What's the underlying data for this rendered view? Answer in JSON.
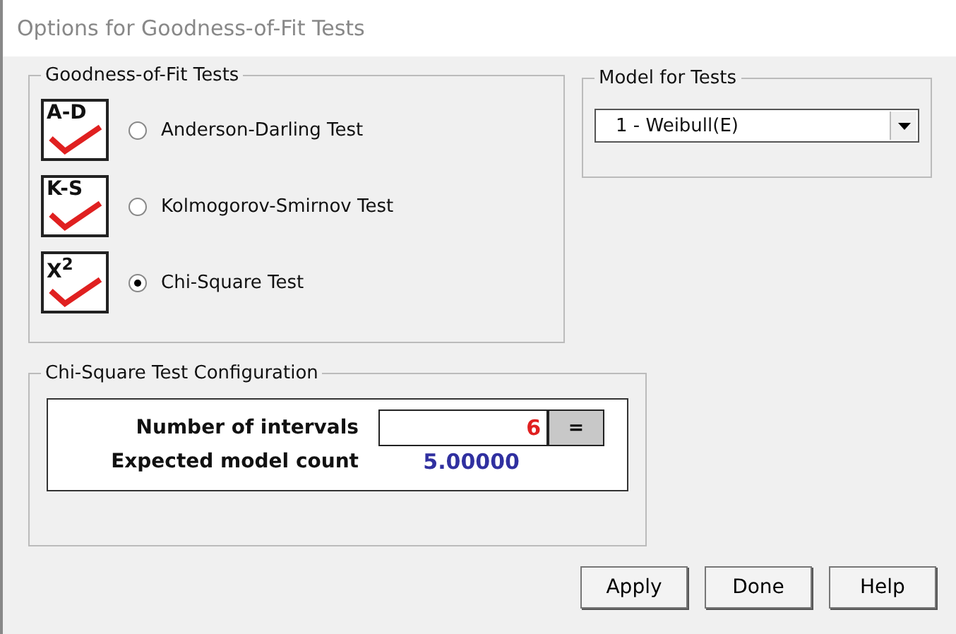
{
  "window": {
    "title": "Options for Goodness-of-Fit Tests"
  },
  "tests_group": {
    "title": "Goodness-of-Fit Tests",
    "tests": [
      {
        "icon_label": "A-D",
        "label": "Anderson-Darling Test",
        "selected": false
      },
      {
        "icon_label": "K-S",
        "label": "Kolmogorov-Smirnov Test",
        "selected": false
      },
      {
        "icon_label": "X$^{2}$",
        "label": "Chi-Square Test",
        "selected": true
      }
    ]
  },
  "model_group": {
    "title": "Model for Tests",
    "value": "1 - Weibull(E)"
  },
  "config_group": {
    "title": "Chi-Square Test Configuration",
    "intervals": {
      "label": "Number of intervals",
      "value": "6",
      "button": "="
    },
    "expected": {
      "label": "Expected model count",
      "value": "5.00000"
    }
  },
  "buttons": [
    "Apply",
    "Done",
    "Help"
  ]
}
